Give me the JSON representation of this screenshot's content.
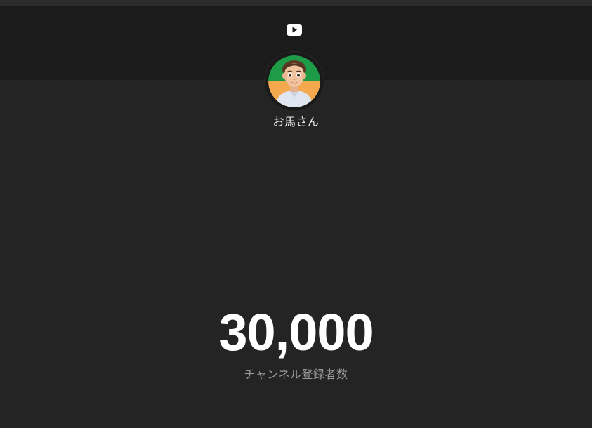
{
  "header": {
    "logo_icon": "youtube-play-icon",
    "logo_color": "#ffffff"
  },
  "channel": {
    "name": "お馬さん",
    "avatar_icon": "memoji-avatar",
    "avatar_colors": [
      "#1e9b47",
      "#f4a94e"
    ]
  },
  "stats": {
    "subscriber_count": "30,000",
    "subscriber_label": "チャンネル登録者数"
  }
}
